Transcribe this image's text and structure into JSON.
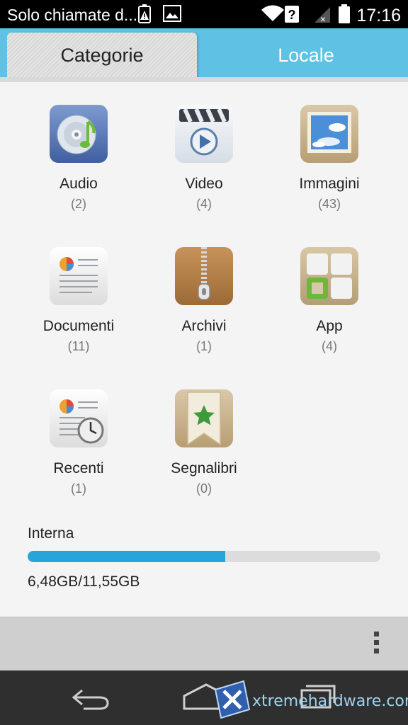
{
  "status_bar": {
    "notification_text": "Solo chiamate d...",
    "time": "17:16"
  },
  "tabs": [
    {
      "label": "Categorie",
      "active": true
    },
    {
      "label": "Locale",
      "active": false
    }
  ],
  "categories": [
    {
      "label": "Audio",
      "count": "(2)",
      "icon": "audio-cd-icon"
    },
    {
      "label": "Video",
      "count": "(4)",
      "icon": "video-clapper-icon"
    },
    {
      "label": "Immagini",
      "count": "(43)",
      "icon": "image-frame-icon"
    },
    {
      "label": "Documenti",
      "count": "(11)",
      "icon": "document-icon"
    },
    {
      "label": "Archivi",
      "count": "(1)",
      "icon": "zip-archive-icon"
    },
    {
      "label": "App",
      "count": "(4)",
      "icon": "app-grid-icon"
    },
    {
      "label": "Recenti",
      "count": "(1)",
      "icon": "recent-clock-icon"
    },
    {
      "label": "Segnalibri",
      "count": "(0)",
      "icon": "bookmark-star-icon"
    }
  ],
  "storage": {
    "title": "Interna",
    "usage_text": "6,48GB/11,55GB",
    "used_fraction": 0.561
  },
  "watermark": "xtremehardware.com",
  "colors": {
    "tab_bar": "#5fc1e4",
    "storage_fill": "#27a4d9",
    "status_bar": "#000000",
    "nav_bar": "#2f2f2f"
  }
}
